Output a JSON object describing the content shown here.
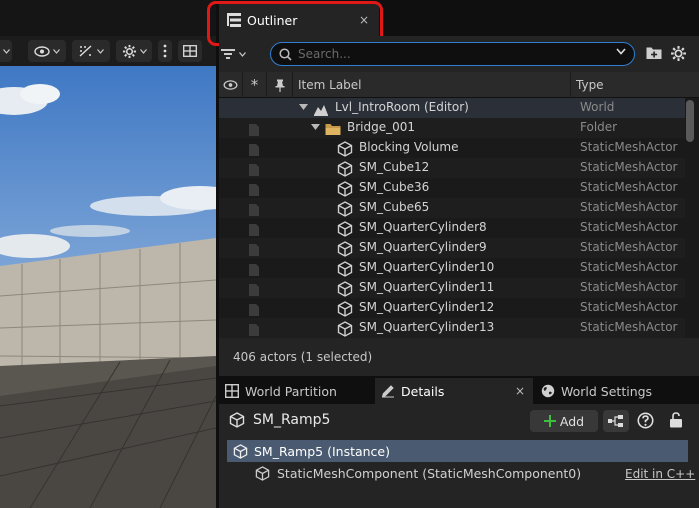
{
  "colors": {
    "accent_blue": "#2f7fd4",
    "highlight_red": "#e01818",
    "selected_row": "#4a5a70",
    "add_plus_green": "#3fbf3f"
  },
  "outliner": {
    "tab_label": "Outliner",
    "close_glyph": "×",
    "search_placeholder": "Search...",
    "columns": {
      "item_label": "Item Label",
      "type": "Type"
    },
    "rows": [
      {
        "label": "Lvl_IntroRoom (Editor)",
        "type": "World",
        "icon": "world-icon",
        "depth": 0
      },
      {
        "label": "Bridge_001",
        "type": "Folder",
        "icon": "folder-icon",
        "depth": 1
      },
      {
        "label": "Blocking Volume",
        "type": "StaticMeshActor",
        "icon": "static-mesh-icon",
        "depth": 2
      },
      {
        "label": "SM_Cube12",
        "type": "StaticMeshActor",
        "icon": "static-mesh-icon",
        "depth": 2
      },
      {
        "label": "SM_Cube36",
        "type": "StaticMeshActor",
        "icon": "static-mesh-icon",
        "depth": 2
      },
      {
        "label": "SM_Cube65",
        "type": "StaticMeshActor",
        "icon": "static-mesh-icon",
        "depth": 2
      },
      {
        "label": "SM_QuarterCylinder8",
        "type": "StaticMeshActor",
        "icon": "static-mesh-icon",
        "depth": 2
      },
      {
        "label": "SM_QuarterCylinder9",
        "type": "StaticMeshActor",
        "icon": "static-mesh-icon",
        "depth": 2
      },
      {
        "label": "SM_QuarterCylinder10",
        "type": "StaticMeshActor",
        "icon": "static-mesh-icon",
        "depth": 2
      },
      {
        "label": "SM_QuarterCylinder11",
        "type": "StaticMeshActor",
        "icon": "static-mesh-icon",
        "depth": 2
      },
      {
        "label": "SM_QuarterCylinder12",
        "type": "StaticMeshActor",
        "icon": "static-mesh-icon",
        "depth": 2
      },
      {
        "label": "SM_QuarterCylinder13",
        "type": "StaticMeshActor",
        "icon": "static-mesh-icon",
        "depth": 2
      }
    ],
    "status": "406 actors (1 selected)"
  },
  "bottom_tabs": {
    "world_partition": "World Partition",
    "details": "Details",
    "world_settings": "World Settings"
  },
  "details": {
    "actor_name": "SM_Ramp5",
    "add_label": "Add",
    "root_component": "SM_Ramp5 (Instance)",
    "child_component": "StaticMeshComponent (StaticMeshComponent0)",
    "edit_link": "Edit in C++"
  }
}
